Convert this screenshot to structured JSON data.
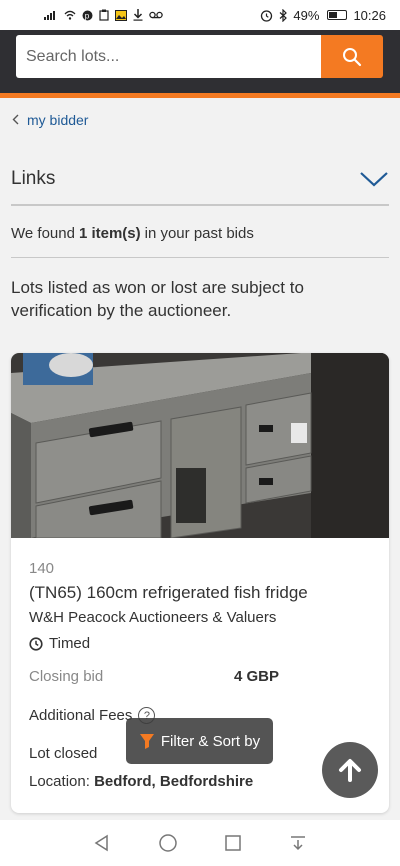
{
  "status_bar": {
    "left_icons": [
      "signal-icon",
      "wifi-icon",
      "pinterest-icon",
      "clipboard-icon",
      "image-icon",
      "download-icon",
      "voicemail-icon"
    ],
    "alarm_icon": "alarm-icon",
    "bluetooth_icon": "bluetooth-icon",
    "battery": "49%",
    "time": "10:26"
  },
  "search": {
    "placeholder": "Search lots..."
  },
  "breadcrumb": {
    "back_label": "my bidder"
  },
  "links_section": {
    "title": "Links"
  },
  "results": {
    "prefix": "We found",
    "count": "1 item(s)",
    "suffix": "in your past bids"
  },
  "notice": "Lots listed as won or lost are subject to verification by the auctioneer.",
  "lot": {
    "number": "140",
    "title": "(TN65) 160cm refrigerated fish fridge",
    "auctioneer": "W&H Peacock Auctioneers & Valuers",
    "type": "Timed",
    "closing_label": "Closing bid",
    "closing_value": "4 GBP",
    "fees_label": "Additional Fees",
    "status": "Lot closed",
    "location_label": "Location:",
    "location_value": "Bedford, Bedfordshire"
  },
  "filter_button": "Filter & Sort by",
  "colors": {
    "accent": "#f47a22",
    "header": "#2f2f33",
    "link": "#1f5a96"
  }
}
